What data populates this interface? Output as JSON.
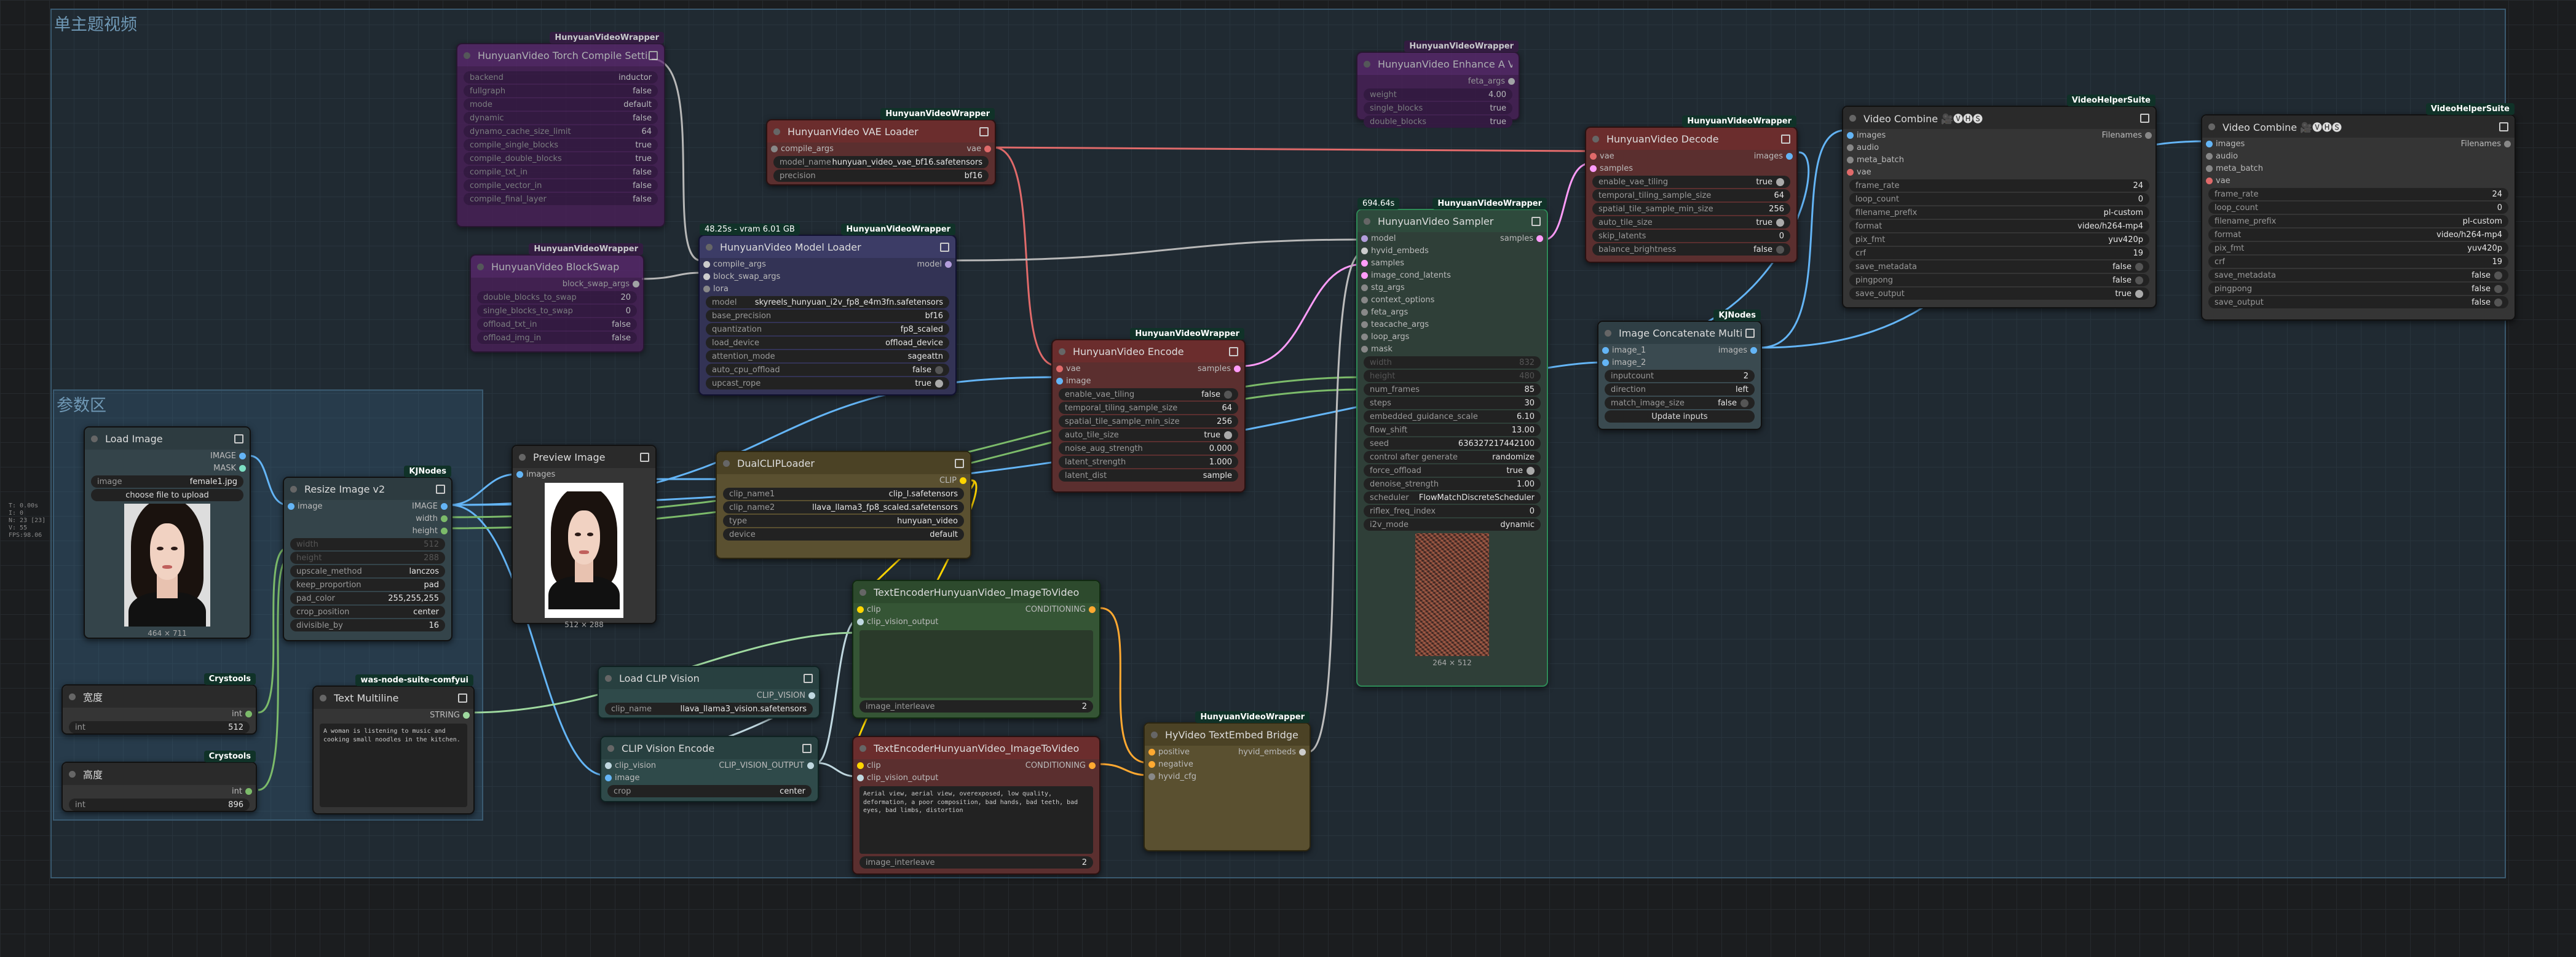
{
  "groups": {
    "main_title": "单主题视频",
    "params_title": "参数区"
  },
  "stats": [
    "T: 0.00s",
    "I: 0",
    "N: 23 [23]",
    "V: 55",
    "FPS:98.06"
  ],
  "colors": {
    "link_vae": "#e06a6a",
    "link_image": "#64b5f6",
    "link_model": "#b39ddb",
    "link_clip": "#ffd500",
    "link_latent": "#ff9cf9",
    "link_int": "#7cbb6a",
    "conditioning": "#ffa931"
  },
  "nodes": {
    "torch_compile": {
      "badge": "HunyuanVideoWrapper",
      "title": "HunyuanVideo Torch Compile Settings",
      "widgets": [
        {
          "k": "backend",
          "v": "inductor"
        },
        {
          "k": "fullgraph",
          "v": "false"
        },
        {
          "k": "mode",
          "v": "default"
        },
        {
          "k": "dynamic",
          "v": "false"
        },
        {
          "k": "dynamo_cache_size_limit",
          "v": "64"
        },
        {
          "k": "compile_single_blocks",
          "v": "true"
        },
        {
          "k": "compile_double_blocks",
          "v": "true"
        },
        {
          "k": "compile_txt_in",
          "v": "false"
        },
        {
          "k": "compile_vector_in",
          "v": "false"
        },
        {
          "k": "compile_final_layer",
          "v": "false"
        }
      ]
    },
    "block_swap": {
      "badge": "HunyuanVideoWrapper",
      "title": "HunyuanVideo BlockSwap",
      "output": "block_swap_args",
      "widgets": [
        {
          "k": "double_blocks_to_swap",
          "v": "20"
        },
        {
          "k": "single_blocks_to_swap",
          "v": "0"
        },
        {
          "k": "offload_txt_in",
          "v": "false"
        },
        {
          "k": "offload_img_in",
          "v": "false"
        }
      ]
    },
    "vae_loader": {
      "badge": "HunyuanVideoWrapper",
      "title": "HunyuanVideo VAE Loader",
      "input": "compile_args",
      "output": "vae",
      "widgets": [
        {
          "k": "model_name",
          "v": "hunyuan_video_vae_bf16.safetensors"
        },
        {
          "k": "precision",
          "v": "bf16"
        }
      ]
    },
    "model_loader": {
      "badge": "HunyuanVideoWrapper",
      "badge_left": "48.25s - vram 6.01 GB",
      "title": "HunyuanVideo Model Loader",
      "inputs": [
        "compile_args",
        "block_swap_args",
        "lora"
      ],
      "output": "model",
      "widgets": [
        {
          "k": "model",
          "v": "skyreels_hunyuan_i2v_fp8_e4m3fn.safetensors"
        },
        {
          "k": "base_precision",
          "v": "bf16"
        },
        {
          "k": "quantization",
          "v": "fp8_scaled"
        },
        {
          "k": "load_device",
          "v": "offload_device"
        },
        {
          "k": "attention_mode",
          "v": "sageattn"
        },
        {
          "k": "auto_cpu_offload",
          "v": "false"
        },
        {
          "k": "upcast_rope",
          "v": "true"
        }
      ]
    },
    "enhance": {
      "badge": "HunyuanVideoWrapper",
      "title": "HunyuanVideo Enhance A Video",
      "output": "feta_args",
      "widgets": [
        {
          "k": "weight",
          "v": "4.00"
        },
        {
          "k": "single_blocks",
          "v": "true"
        },
        {
          "k": "double_blocks",
          "v": "true"
        }
      ]
    },
    "encode": {
      "badge": "HunyuanVideoWrapper",
      "title": "HunyuanVideo Encode",
      "inputs": [
        "vae",
        "image"
      ],
      "output": "samples",
      "widgets": [
        {
          "k": "enable_vae_tiling",
          "v": "false"
        },
        {
          "k": "temporal_tiling_sample_size",
          "v": "64"
        },
        {
          "k": "spatial_tile_sample_min_size",
          "v": "256"
        },
        {
          "k": "auto_tile_size",
          "v": "true"
        },
        {
          "k": "noise_aug_strength",
          "v": "0.000"
        },
        {
          "k": "latent_strength",
          "v": "1.000"
        },
        {
          "k": "latent_dist",
          "v": "sample"
        }
      ]
    },
    "sampler": {
      "badge": "HunyuanVideoWrapper",
      "badge_left": "694.64s",
      "title": "HunyuanVideo Sampler",
      "inputs": [
        "model",
        "hyvid_embeds",
        "samples",
        "image_cond_latents",
        "stg_args",
        "context_options",
        "feta_args",
        "teacache_args",
        "loop_args",
        "mask"
      ],
      "output": "samples",
      "disabled": [
        {
          "k": "width",
          "v": "832"
        },
        {
          "k": "height",
          "v": "480"
        }
      ],
      "widgets": [
        {
          "k": "num_frames",
          "v": "85"
        },
        {
          "k": "steps",
          "v": "30"
        },
        {
          "k": "embedded_guidance_scale",
          "v": "6.10"
        },
        {
          "k": "flow_shift",
          "v": "13.00"
        },
        {
          "k": "seed",
          "v": "636327217442100"
        },
        {
          "k": "control after generate",
          "v": "randomize"
        },
        {
          "k": "force_offload",
          "v": "true"
        },
        {
          "k": "denoise_strength",
          "v": "1.00"
        },
        {
          "k": "scheduler",
          "v": "FlowMatchDiscreteScheduler"
        },
        {
          "k": "riflex_freq_index",
          "v": "0"
        },
        {
          "k": "i2v_mode",
          "v": "dynamic"
        }
      ],
      "preview_caption": "264 × 512"
    },
    "decode": {
      "badge": "HunyuanVideoWrapper",
      "title": "HunyuanVideo Decode",
      "inputs": [
        "vae",
        "samples"
      ],
      "output": "images",
      "widgets": [
        {
          "k": "enable_vae_tiling",
          "v": "true"
        },
        {
          "k": "temporal_tiling_sample_size",
          "v": "64"
        },
        {
          "k": "spatial_tile_sample_min_size",
          "v": "256"
        },
        {
          "k": "auto_tile_size",
          "v": "true"
        },
        {
          "k": "skip_latents",
          "v": "0"
        },
        {
          "k": "balance_brightness",
          "v": "false"
        }
      ]
    },
    "concat": {
      "badge": "KJNodes",
      "title": "Image Concatenate Multi",
      "inputs": [
        "image_1",
        "image_2"
      ],
      "output": "images",
      "widgets": [
        {
          "k": "inputcount",
          "v": "2"
        },
        {
          "k": "direction",
          "v": "left"
        },
        {
          "k": "match_image_size",
          "v": "false"
        }
      ],
      "button": "Update inputs"
    },
    "vc1": {
      "badge": "VideoHelperSuite",
      "title": "Video Combine 🎥🅥🅗🅢",
      "inputs": [
        "images",
        "audio",
        "meta_batch",
        "vae"
      ],
      "output": "Filenames",
      "widgets": [
        {
          "k": "frame_rate",
          "v": "24"
        },
        {
          "k": "loop_count",
          "v": "0"
        },
        {
          "k": "filename_prefix",
          "v": "pl-custom"
        },
        {
          "k": "format",
          "v": "video/h264-mp4"
        },
        {
          "k": "pix_fmt",
          "v": "yuv420p"
        },
        {
          "k": "crf",
          "v": "19"
        },
        {
          "k": "save_metadata",
          "v": "false"
        },
        {
          "k": "pingpong",
          "v": "false"
        },
        {
          "k": "save_output",
          "v": "true"
        }
      ]
    },
    "vc2": {
      "badge": "VideoHelperSuite",
      "title": "Video Combine 🎥🅥🅗🅢",
      "inputs": [
        "images",
        "audio",
        "meta_batch",
        "vae"
      ],
      "output": "Filenames",
      "widgets": [
        {
          "k": "frame_rate",
          "v": "24"
        },
        {
          "k": "loop_count",
          "v": "0"
        },
        {
          "k": "filename_prefix",
          "v": "pl-custom"
        },
        {
          "k": "format",
          "v": "video/h264-mp4"
        },
        {
          "k": "pix_fmt",
          "v": "yuv420p"
        },
        {
          "k": "crf",
          "v": "19"
        },
        {
          "k": "save_metadata",
          "v": "false"
        },
        {
          "k": "pingpong",
          "v": "false"
        },
        {
          "k": "save_output",
          "v": "false"
        }
      ]
    },
    "load_image": {
      "title": "Load Image",
      "outputs": [
        "IMAGE",
        "MASK"
      ],
      "widgets": [
        {
          "k": "image",
          "v": "female1.jpg"
        }
      ],
      "button": "choose file to upload",
      "caption": "464 × 711"
    },
    "resize": {
      "badge": "KJNodes",
      "title": "Resize Image v2",
      "input": "image",
      "outputs": [
        "IMAGE",
        "width",
        "height"
      ],
      "disabled": [
        {
          "k": "width",
          "v": "512"
        },
        {
          "k": "height",
          "v": "288"
        }
      ],
      "widgets": [
        {
          "k": "upscale_method",
          "v": "lanczos"
        },
        {
          "k": "keep_proportion",
          "v": "pad"
        },
        {
          "k": "pad_color",
          "v": "255,255,255"
        },
        {
          "k": "crop_position",
          "v": "center"
        },
        {
          "k": "divisible_by",
          "v": "16"
        }
      ]
    },
    "preview": {
      "title": "Preview Image",
      "input": "images",
      "caption": "512 × 288"
    },
    "dualclip": {
      "title": "DualCLIPLoader",
      "output": "CLIP",
      "widgets": [
        {
          "k": "clip_name1",
          "v": "clip_l.safetensors"
        },
        {
          "k": "clip_name2",
          "v": "llava_llama3_fp8_scaled.safetensors"
        },
        {
          "k": "type",
          "v": "hunyuan_video"
        },
        {
          "k": "device",
          "v": "default"
        }
      ]
    },
    "te_pos": {
      "title": "TextEncoderHunyuanVideo_ImageToVideo",
      "inputs": [
        "clip",
        "clip_vision_output"
      ],
      "output": "CONDITIONING",
      "widgets": [
        {
          "k": "image_interleave",
          "v": "2"
        }
      ]
    },
    "te_neg": {
      "title": "TextEncoderHunyuanVideo_ImageToVideo",
      "inputs": [
        "clip",
        "clip_vision_output"
      ],
      "output": "CONDITIONING",
      "text": "Aerial view, aerial view, overexposed, low quality, deformation, a poor composition, bad hands, bad teeth, bad eyes, bad limbs, distortion",
      "widgets": [
        {
          "k": "image_interleave",
          "v": "2"
        }
      ]
    },
    "bridge": {
      "badge": "HunyuanVideoWrapper",
      "title": "HyVideo TextEmbed Bridge",
      "inputs": [
        "positive",
        "negative",
        "hyvid_cfg"
      ],
      "output": "hyvid_embeds"
    },
    "load_clip_vision": {
      "title": "Load CLIP Vision",
      "output": "CLIP_VISION",
      "widgets": [
        {
          "k": "clip_name",
          "v": "llava_llama3_vision.safetensors"
        }
      ]
    },
    "clip_vision_encode": {
      "title": "CLIP Vision Encode",
      "inputs": [
        "clip_vision",
        "image"
      ],
      "output": "CLIP_VISION_OUTPUT",
      "widgets": [
        {
          "k": "crop",
          "v": "center"
        }
      ]
    },
    "text_multiline": {
      "badge": "was-node-suite-comfyui",
      "title": "Text Multiline",
      "output": "STRING",
      "text": "A woman is listening to music and cooking small noodles in the kitchen."
    },
    "width_node": {
      "badge": "Crystools",
      "title": "宽度",
      "output": "int",
      "widgets": [
        {
          "k": "int",
          "v": "512"
        }
      ]
    },
    "height_node": {
      "badge": "Crystools",
      "title": "高度",
      "output": "int",
      "widgets": [
        {
          "k": "int",
          "v": "896"
        }
      ]
    }
  }
}
